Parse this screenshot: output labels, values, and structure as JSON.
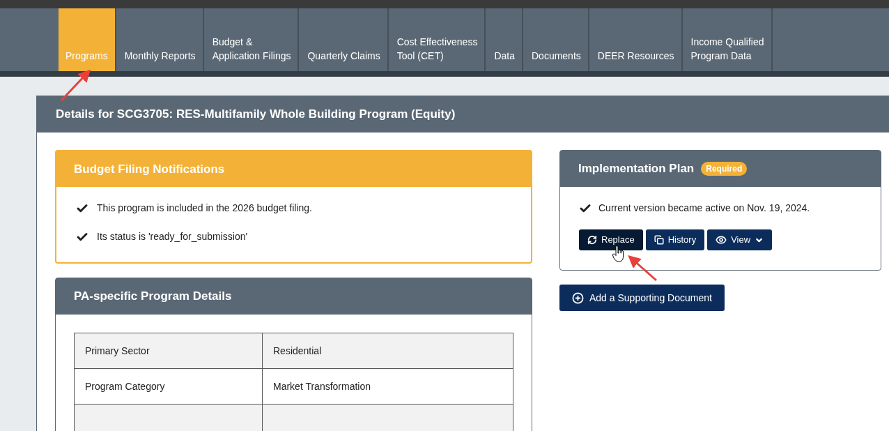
{
  "nav": {
    "tabs": [
      {
        "lines": [
          "Programs"
        ],
        "selected": true
      },
      {
        "lines": [
          "Monthly Reports"
        ],
        "selected": false
      },
      {
        "lines": [
          "Budget &",
          "Application Filings"
        ],
        "selected": false
      },
      {
        "lines": [
          "Quarterly Claims"
        ],
        "selected": false
      },
      {
        "lines": [
          "Cost Effectiveness",
          "Tool (CET)"
        ],
        "selected": false
      },
      {
        "lines": [
          "Data"
        ],
        "selected": false
      },
      {
        "lines": [
          "Documents"
        ],
        "selected": false
      },
      {
        "lines": [
          "DEER Resources"
        ],
        "selected": false
      },
      {
        "lines": [
          "Income Qualified",
          "Program Data"
        ],
        "selected": false
      }
    ]
  },
  "details": {
    "title": "Details for SCG3705: RES-Multifamily Whole Building Program (Equity)",
    "notifications": {
      "title": "Budget Filing Notifications",
      "items": [
        "This program is included in the 2026 budget filing.",
        "Its status is 'ready_for_submission'"
      ]
    },
    "program_details": {
      "title": "PA-specific Program Details",
      "rows": [
        {
          "label": "Primary Sector",
          "value": "Residential"
        },
        {
          "label": "Program Category",
          "value": "Market Transformation"
        },
        {}
      ]
    },
    "implementation_plan": {
      "title": "Implementation Plan",
      "badge": "Required",
      "status": "Current version became active on Nov. 19, 2024.",
      "buttons": [
        {
          "kind": "replace",
          "label": "Replace",
          "hovered": true
        },
        {
          "kind": "history",
          "label": "History",
          "hovered": false
        },
        {
          "kind": "view",
          "label": "View",
          "hovered": false
        }
      ]
    },
    "add_button": "Add a Supporting Document"
  }
}
